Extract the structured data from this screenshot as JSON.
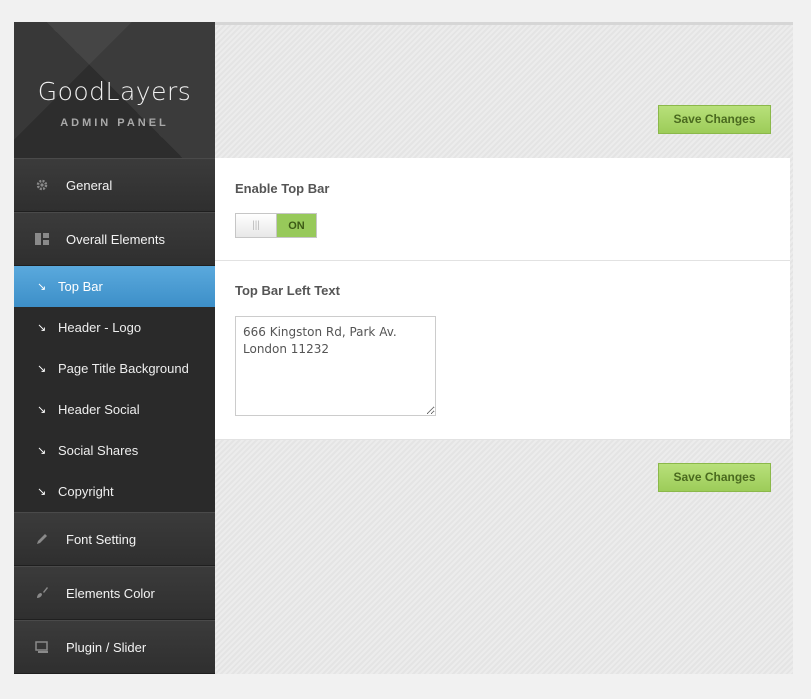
{
  "brand": {
    "title": "GoodLayers",
    "subtitle": "ADMIN PANEL"
  },
  "sidebar": {
    "main_items": [
      {
        "label": "General",
        "icon": "gear-icon"
      },
      {
        "label": "Overall Elements",
        "icon": "layout-icon"
      },
      {
        "label": "Font Setting",
        "icon": "pencil-icon"
      },
      {
        "label": "Elements Color",
        "icon": "brush-icon"
      },
      {
        "label": "Plugin / Slider",
        "icon": "slider-icon"
      }
    ],
    "sub_items": [
      {
        "label": "Top Bar",
        "active": true
      },
      {
        "label": "Header - Logo"
      },
      {
        "label": "Page Title Background"
      },
      {
        "label": "Header Social"
      },
      {
        "label": "Social Shares"
      },
      {
        "label": "Copyright"
      }
    ]
  },
  "content": {
    "save_top": "Save Changes",
    "save_bottom": "Save Changes",
    "enable_top_bar": {
      "label": "Enable Top Bar",
      "state": "ON",
      "knob": "|||"
    },
    "top_bar_left_text": {
      "label": "Top Bar Left Text",
      "value": "666 Kingston Rd, Park Av.\nLondon 11232"
    }
  },
  "colors": {
    "accent_active": "#4a9cd4",
    "save_button": "#a7d463",
    "toggle_on": "#97c95a",
    "sidebar_bg": "#2f2f2f"
  }
}
